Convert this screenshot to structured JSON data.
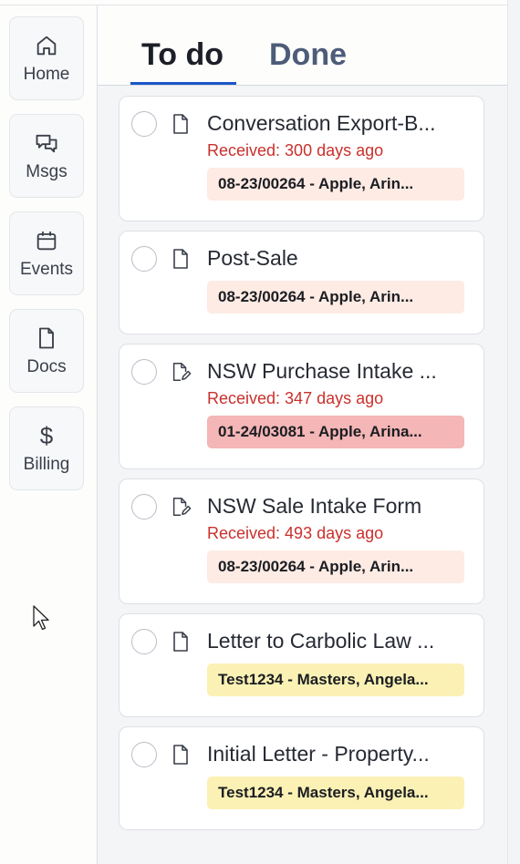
{
  "sidebar": {
    "items": [
      {
        "label": "Home",
        "icon": "home-icon"
      },
      {
        "label": "Msgs",
        "icon": "messages-icon"
      },
      {
        "label": "Events",
        "icon": "calendar-icon"
      },
      {
        "label": "Docs",
        "icon": "document-icon"
      },
      {
        "label": "Billing",
        "icon": "dollar-icon",
        "glyph": "$"
      }
    ]
  },
  "tabs": [
    {
      "label": "To do",
      "active": true
    },
    {
      "label": "Done",
      "active": false
    }
  ],
  "colors": {
    "accent": "#1a56c8",
    "received_text": "#c9302c",
    "badge_peach": "#fdebe4",
    "badge_red": "#f4b6b6",
    "badge_yellow": "#fbf1b5"
  },
  "tasks": [
    {
      "title": "Conversation Export-B...",
      "received": "Received: 300 days ago",
      "badge": "08-23/00264 - Apple, Arin...",
      "icon": "document-icon"
    },
    {
      "title": "Post-Sale",
      "badge": "08-23/00264 - Apple, Arin...",
      "icon": "document-icon"
    },
    {
      "title": "NSW Purchase Intake ...",
      "received": "Received: 347 days ago",
      "badge": "01-24/03081 - Apple, Arina...",
      "icon": "document-edit-icon"
    },
    {
      "title": "NSW Sale Intake Form",
      "received": "Received: 493 days ago",
      "badge": "08-23/00264 - Apple, Arin...",
      "icon": "document-edit-icon"
    },
    {
      "title": "Letter to Carbolic Law ...",
      "badge": "Test1234 - Masters, Angela...",
      "icon": "document-icon"
    },
    {
      "title": "Initial Letter - Property...",
      "badge": "Test1234 - Masters, Angela...",
      "icon": "document-icon"
    }
  ]
}
